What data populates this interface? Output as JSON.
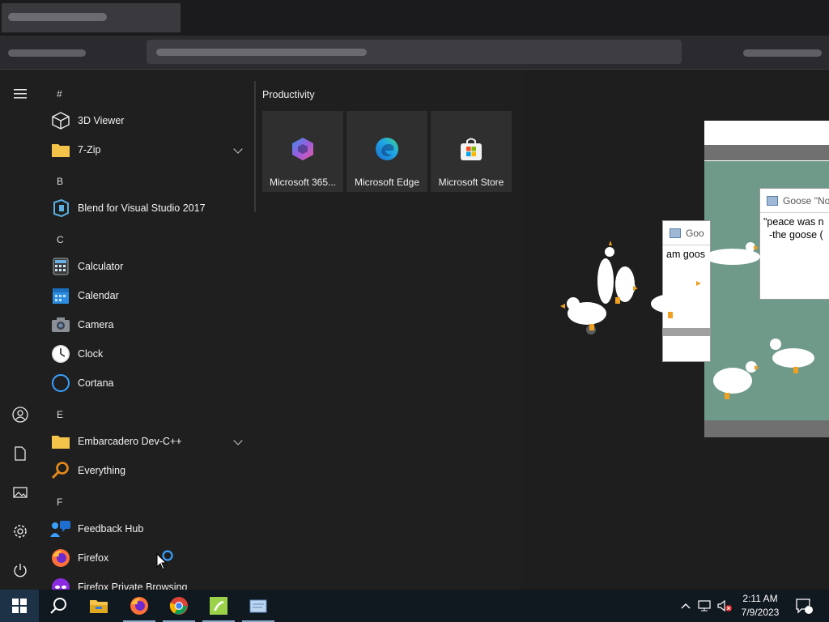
{
  "start_menu": {
    "groups": [
      "#",
      "B",
      "C",
      "E",
      "F"
    ],
    "apps": [
      {
        "label": "3D Viewer",
        "icon": "cube-icon"
      },
      {
        "label": "7-Zip",
        "icon": "folder-icon",
        "expandable": true
      },
      {
        "label": "Blend for Visual Studio 2017",
        "icon": "blend-icon"
      },
      {
        "label": "Calculator",
        "icon": "calculator-icon"
      },
      {
        "label": "Calendar",
        "icon": "calendar-icon"
      },
      {
        "label": "Camera",
        "icon": "camera-icon"
      },
      {
        "label": "Clock",
        "icon": "clock-icon"
      },
      {
        "label": "Cortana",
        "icon": "cortana-icon"
      },
      {
        "label": "Embarcadero Dev-C++",
        "icon": "folder-icon",
        "expandable": true
      },
      {
        "label": "Everything",
        "icon": "magnifier-icon"
      },
      {
        "label": "Feedback Hub",
        "icon": "feedback-icon"
      },
      {
        "label": "Firefox",
        "icon": "firefox-icon"
      },
      {
        "label": "Firefox Private Browsing",
        "icon": "firefox-private-icon"
      }
    ],
    "tiles_group": "Productivity",
    "tiles": [
      {
        "label": "Microsoft 365...",
        "icon": "microsoft-365-icon"
      },
      {
        "label": "Microsoft Edge",
        "icon": "edge-icon"
      },
      {
        "label": "Microsoft Store",
        "icon": "store-icon"
      }
    ]
  },
  "desktop": {
    "notepad_small": {
      "title": "Goo",
      "text": "am goos"
    },
    "notepad_large": {
      "title": "Goose \"No",
      "text": "\"peace was n\n  -the goose ("
    }
  },
  "taskbar": {
    "time": "2:11 AM",
    "date": "7/9/2023",
    "notification_count": "1"
  },
  "colors": {
    "start_bg": "#1f1f1f",
    "taskbar_bg": "#101820",
    "tile_bg": "#2f2f2f",
    "goose_window_green": "#6f9a8a"
  }
}
